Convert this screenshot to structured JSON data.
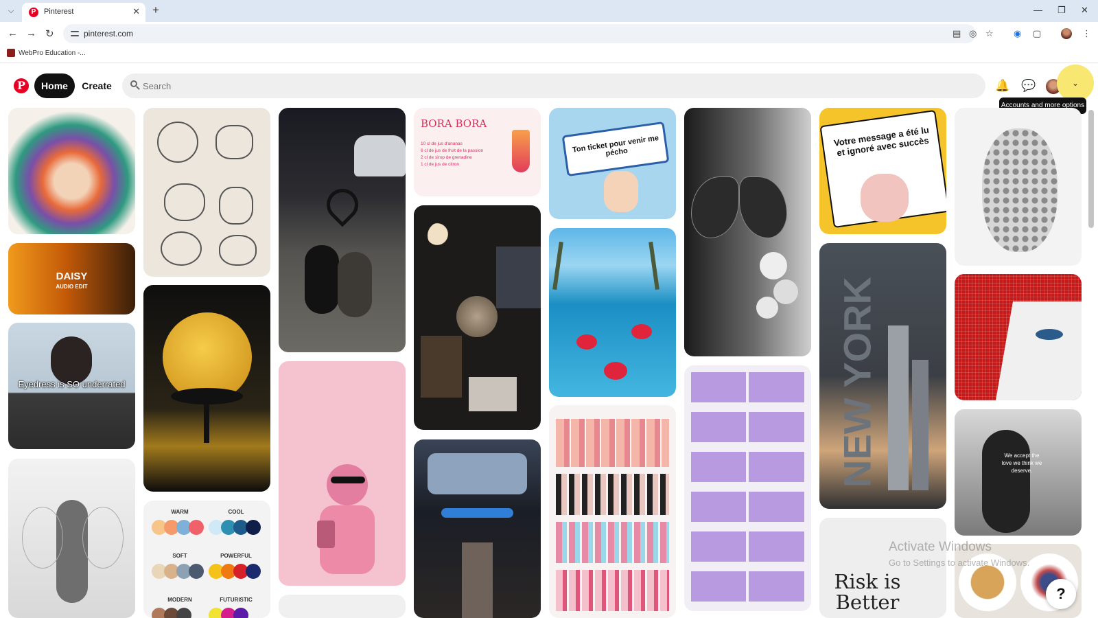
{
  "browser": {
    "tab_title": "Pinterest",
    "favicon_letter": "P",
    "url": "pinterest.com",
    "bookmark_label": "WebPro Education -..."
  },
  "header": {
    "logo_letter": "P",
    "home_label": "Home",
    "create_label": "Create",
    "search_placeholder": "Search",
    "tooltip": "Accounts and more options"
  },
  "pins": {
    "daisy_title": "DAISY",
    "daisy_sub": "AUDIO EDIT",
    "eyedress_caption": "Eyedress is SO underrated",
    "bora_title": "BORA BORA",
    "bora_lines": [
      "10 cl de jus d'ananas",
      "6 cl de jus de fruit de la passion",
      "2 cl de sirop de grenadine",
      "1 cl de jus de citron"
    ],
    "ticket_text": "Ton ticket pour venir me pécho",
    "message_text": "Votre message a été lu et ignoré avec succès",
    "newyork_text": "NEW YORK",
    "palette_warm": "WARM",
    "palette_cool": "COOL",
    "palette_soft": "SOFT",
    "palette_powerful": "POWERFUL",
    "palette_modern": "MODERN",
    "palette_futuristic": "FUTURISTIC",
    "quote_text": "We accept the love we think we deserve.",
    "risk_text": "Risk is Better"
  },
  "system": {
    "watermark_title": "Activate Windows",
    "watermark_sub": "Go to Settings to activate Windows.",
    "help_label": "?"
  },
  "colors": {
    "brand_red": "#e60023",
    "accent_yellow": "#f8e770"
  }
}
